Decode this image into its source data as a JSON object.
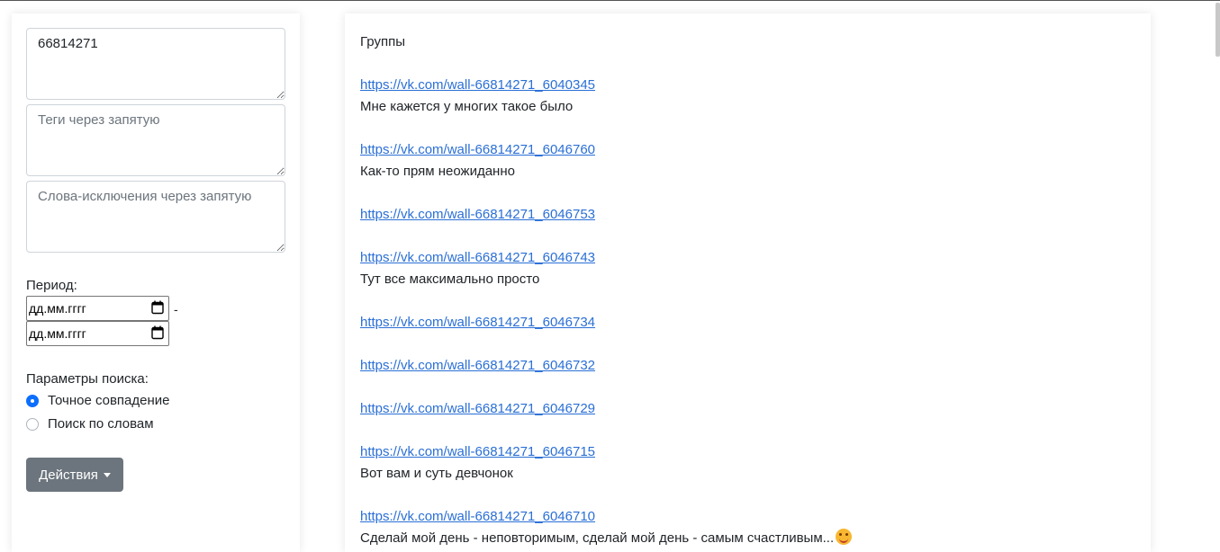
{
  "form": {
    "group_id_value": "66814271",
    "tags_placeholder": "Теги через запятую",
    "exclude_placeholder": "Слова-исключения через запятую",
    "period_label": "Период:",
    "date_from_placeholder": "дд.мм.гггг",
    "date_to_placeholder": "дд.мм.гггг",
    "date_separator": "-",
    "search_params_label": "Параметры поиска:",
    "radio_options": [
      {
        "label": "Точное совпадение",
        "checked": true
      },
      {
        "label": "Поиск по словам",
        "checked": false
      }
    ],
    "actions_button_label": "Действия",
    "accent_color": "#0d6efd",
    "button_color": "#6c757d"
  },
  "results": {
    "heading": "Группы",
    "link_color": "#2a6fd6",
    "posts": [
      {
        "url": "https://vk.com/wall-66814271_6040345",
        "text": "Мне кажется у многих такое было"
      },
      {
        "url": "https://vk.com/wall-66814271_6046760",
        "text": "Как-то прям неожиданно"
      },
      {
        "url": "https://vk.com/wall-66814271_6046753",
        "text": ""
      },
      {
        "url": "https://vk.com/wall-66814271_6046743",
        "text": "Тут все максимально просто"
      },
      {
        "url": "https://vk.com/wall-66814271_6046734",
        "text": ""
      },
      {
        "url": "https://vk.com/wall-66814271_6046732",
        "text": ""
      },
      {
        "url": "https://vk.com/wall-66814271_6046729",
        "text": ""
      },
      {
        "url": "https://vk.com/wall-66814271_6046715",
        "text": "Вот вам и суть девчонок"
      },
      {
        "url": "https://vk.com/wall-66814271_6046710",
        "text": "Сделай мой день - неповторимым, сделай мой день - самым счастливым...",
        "emoji": "smiling-face-with-hearts-icon"
      }
    ]
  }
}
